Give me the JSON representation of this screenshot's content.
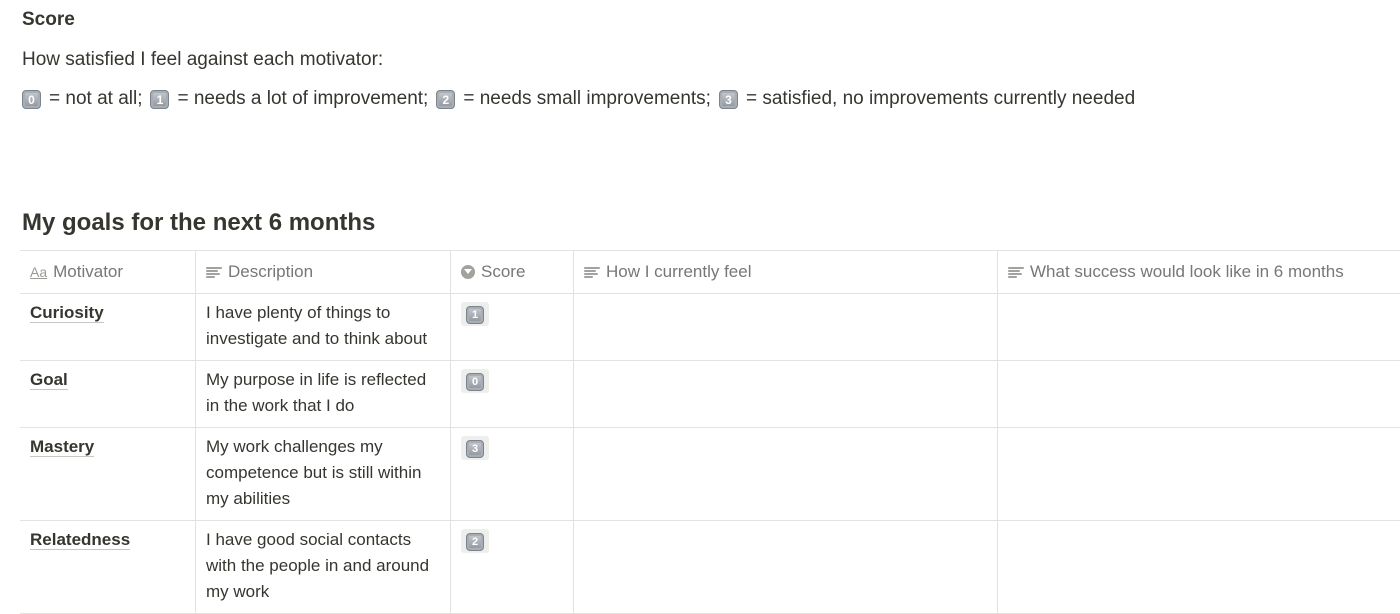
{
  "score_section": {
    "heading": "Score",
    "intro": "How satisfied I feel against each motivator:",
    "legend": [
      {
        "key": "0",
        "text": " = not at all;"
      },
      {
        "key": "1",
        "text": " = needs a lot of improvement;"
      },
      {
        "key": "2",
        "text": " = needs small improvements;"
      },
      {
        "key": "3",
        "text": " = satisfied, no improvements currently needed"
      }
    ]
  },
  "goals": {
    "heading": "My goals for the next 6 months",
    "columns": [
      {
        "label": "Motivator",
        "icon": "text-title-icon"
      },
      {
        "label": "Description",
        "icon": "text-lines-icon"
      },
      {
        "label": "Score",
        "icon": "select-icon"
      },
      {
        "label": "How I currently feel",
        "icon": "text-lines-icon"
      },
      {
        "label": "What success would look like in 6 months",
        "icon": "text-lines-icon"
      }
    ],
    "rows": [
      {
        "motivator": "Curiosity",
        "description": "I have plenty of things to investigate and to think about",
        "score": "1",
        "feel": "",
        "success": ""
      },
      {
        "motivator": "Goal",
        "description": "My purpose in life is reflected in the work that I do",
        "score": "0",
        "feel": "",
        "success": ""
      },
      {
        "motivator": "Mastery",
        "description": "My work challenges my competence but is still within my abilities",
        "score": "3",
        "feel": "",
        "success": ""
      },
      {
        "motivator": "Relatedness",
        "description": "I have good social contacts with the people in and around my work",
        "score": "2",
        "feel": "",
        "success": ""
      }
    ]
  }
}
